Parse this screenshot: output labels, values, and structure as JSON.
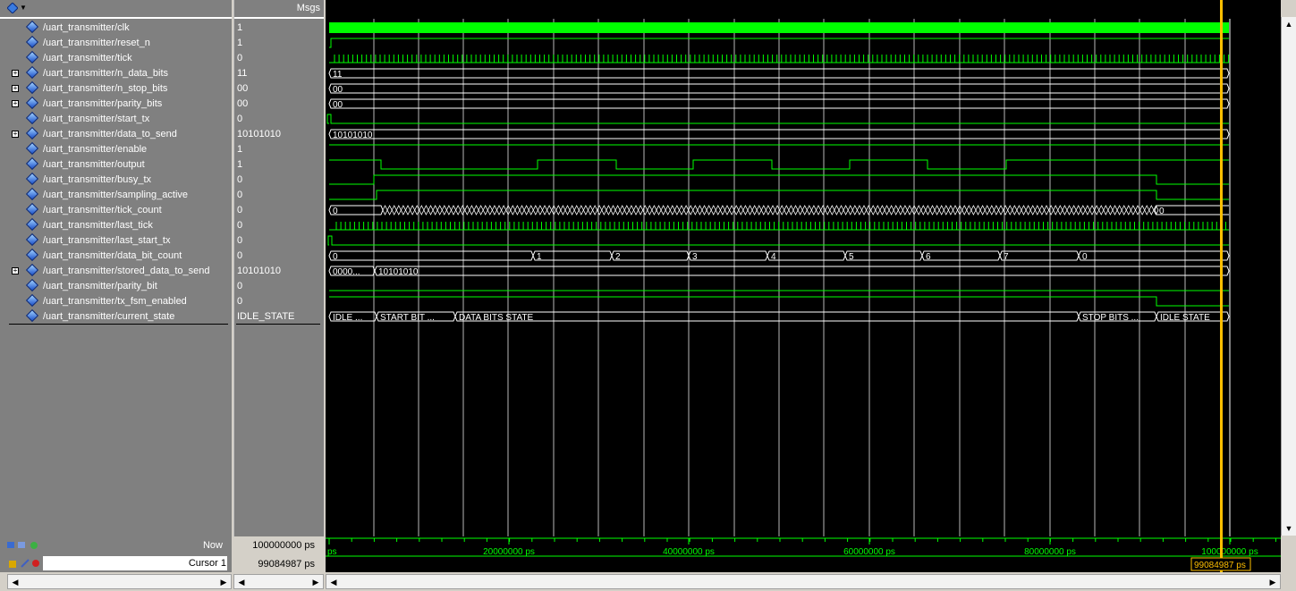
{
  "header": {
    "msgs_label": "Msgs"
  },
  "signals": [
    {
      "name": "/uart_transmitter/clk",
      "value": "1",
      "expandable": false
    },
    {
      "name": "/uart_transmitter/reset_n",
      "value": "1",
      "expandable": false
    },
    {
      "name": "/uart_transmitter/tick",
      "value": "0",
      "expandable": false
    },
    {
      "name": "/uart_transmitter/n_data_bits",
      "value": "11",
      "expandable": true
    },
    {
      "name": "/uart_transmitter/n_stop_bits",
      "value": "00",
      "expandable": true
    },
    {
      "name": "/uart_transmitter/parity_bits",
      "value": "00",
      "expandable": true
    },
    {
      "name": "/uart_transmitter/start_tx",
      "value": "0",
      "expandable": false
    },
    {
      "name": "/uart_transmitter/data_to_send",
      "value": "10101010",
      "expandable": true
    },
    {
      "name": "/uart_transmitter/enable",
      "value": "1",
      "expandable": false
    },
    {
      "name": "/uart_transmitter/output",
      "value": "1",
      "expandable": false
    },
    {
      "name": "/uart_transmitter/busy_tx",
      "value": "0",
      "expandable": false
    },
    {
      "name": "/uart_transmitter/sampling_active",
      "value": "0",
      "expandable": false
    },
    {
      "name": "/uart_transmitter/tick_count",
      "value": "0",
      "expandable": false
    },
    {
      "name": "/uart_transmitter/last_tick",
      "value": "0",
      "expandable": false
    },
    {
      "name": "/uart_transmitter/last_start_tx",
      "value": "0",
      "expandable": false
    },
    {
      "name": "/uart_transmitter/data_bit_count",
      "value": "0",
      "expandable": false
    },
    {
      "name": "/uart_transmitter/stored_data_to_send",
      "value": "10101010",
      "expandable": true
    },
    {
      "name": "/uart_transmitter/parity_bit",
      "value": "0",
      "expandable": false
    },
    {
      "name": "/uart_transmitter/tx_fsm_enabled",
      "value": "0",
      "expandable": false
    },
    {
      "name": "/uart_transmitter/current_state",
      "value": "IDLE_STATE",
      "expandable": false
    }
  ],
  "wave_labels": {
    "n_data_bits": "11",
    "n_stop_bits": "00",
    "parity_bits": "00",
    "data_to_send": "10101010",
    "tick_count_start": "0",
    "tick_count_end": "0",
    "data_bit_count": [
      "0",
      "1",
      "2",
      "3",
      "4",
      "5",
      "6",
      "7",
      "0"
    ],
    "stored_data_to_send": [
      "0000...",
      "10101010"
    ],
    "current_state": [
      "IDLE ...",
      "START BIT ...",
      "DATA BITS STATE",
      "STOP BITS ...",
      "IDLE STATE"
    ]
  },
  "timeline": {
    "ticks": [
      "ps",
      "20000000 ps",
      "40000000 ps",
      "60000000 ps",
      "80000000 ps",
      "100000000 ps"
    ]
  },
  "status": {
    "now_label": "Now",
    "now_value": "100000000 ps",
    "cursor_label": "Cursor 1",
    "cursor_value": "99084987 ps",
    "cursor_flag": "99084987 ps"
  },
  "colors": {
    "wave": "#00ff00",
    "cursor": "#ffbf00",
    "grid": "#b8b8b8"
  }
}
